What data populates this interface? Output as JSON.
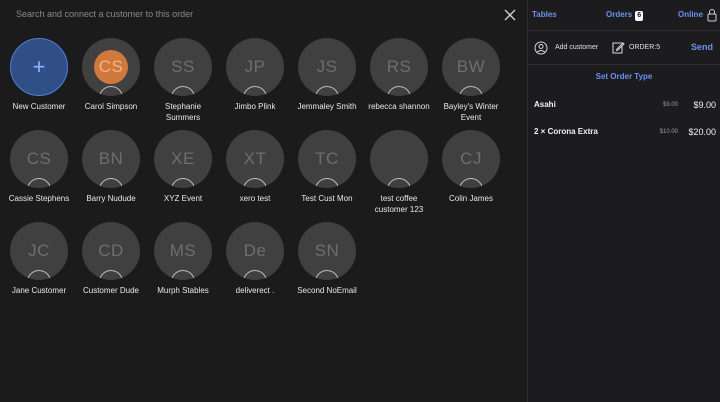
{
  "search": {
    "placeholder": "Search and connect a customer to this order"
  },
  "customers": [
    {
      "initials": "",
      "name": "New Customer",
      "type": "new"
    },
    {
      "initials": "CS",
      "name": "Carol Simpson",
      "type": "selected"
    },
    {
      "initials": "SS",
      "name": "Stephanie Summers"
    },
    {
      "initials": "JP",
      "name": "Jimbo Plink"
    },
    {
      "initials": "JS",
      "name": "Jemmaley Smith"
    },
    {
      "initials": "RS",
      "name": "rebecca shannon"
    },
    {
      "initials": "BW",
      "name": "Bayley's Winter Event"
    },
    {
      "initials": "CS",
      "name": "Cassie Stephens"
    },
    {
      "initials": "BN",
      "name": "Barry Nudude"
    },
    {
      "initials": "XE",
      "name": "XYZ Event"
    },
    {
      "initials": "XT",
      "name": "xero test"
    },
    {
      "initials": "TC",
      "name": "Test Cust Mon"
    },
    {
      "initials": "",
      "name": "test coffee customer 123"
    },
    {
      "initials": "CJ",
      "name": "Colin James"
    },
    {
      "initials": "JC",
      "name": "Jane Customer"
    },
    {
      "initials": "CD",
      "name": "Customer Dude"
    },
    {
      "initials": "MS",
      "name": "Murph Stables"
    },
    {
      "initials": "De",
      "name": "deliverect ."
    },
    {
      "initials": "SN",
      "name": "Second NoEmail"
    }
  ],
  "right": {
    "tabs": {
      "tables": "Tables",
      "orders": "Orders",
      "orders_count": "6",
      "online": "Online"
    },
    "actions": {
      "add_customer": "Add customer",
      "order_number": "ORDER:5",
      "send": "Send"
    },
    "order_type": "Set Order Type",
    "items": [
      {
        "name": "Asahi",
        "unit_price": "$9.00",
        "total": "$9.00"
      },
      {
        "name": "2 × Corona Extra",
        "unit_price": "$10.00",
        "total": "$20.00"
      }
    ]
  },
  "colors": {
    "accent": "#6f8ef2",
    "selected": "#d97c3d",
    "new_customer": "#2f4f86"
  }
}
